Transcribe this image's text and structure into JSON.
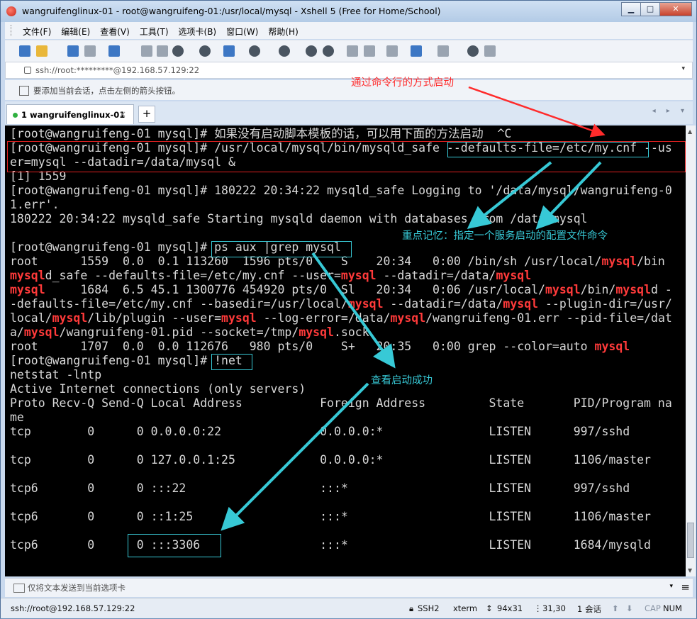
{
  "window": {
    "title": "wangruifenglinux-01 - root@wangruifeng-01:/usr/local/mysql - Xshell 5 (Free for Home/School)",
    "minimize": "▁",
    "maximize": "□",
    "close": "✕"
  },
  "menu": {
    "items": [
      "文件(F)",
      "编辑(E)",
      "查看(V)",
      "工具(T)",
      "选项卡(B)",
      "窗口(W)",
      "帮助(H)"
    ]
  },
  "address": {
    "value": "ssh://root:*********@192.168.57.129:22",
    "dropdown": "▾"
  },
  "hint_bar": {
    "text": "要添加当前会话，点击左侧的箭头按钮。"
  },
  "tabs": {
    "active_label": "1 wangruifenglinux-01",
    "close": "×",
    "add": "+",
    "nav": "◂ ▸ ▾"
  },
  "terminal": {
    "lines": [
      [
        {
          "t": "[root@wangruifeng-01 mysql]# 如果没有启动脚本模板的话，可以用下面的方法启动  ^C",
          "c": ""
        }
      ],
      [
        {
          "t": "[root@wangruifeng-01 mysql]# /usr/local/mysql/bin/mysqld_safe --defaults-file=/etc/my.cnf --us",
          "c": ""
        }
      ],
      [
        {
          "t": "er=mysql --datadir=/data/mysql &",
          "c": ""
        }
      ],
      [
        {
          "t": "[1] 1559",
          "c": ""
        }
      ],
      [
        {
          "t": "[root@wangruifeng-01 mysql]# 180222 20:34:22 mysqld_safe Logging to '/data/mysql/wangruifeng-0",
          "c": ""
        }
      ],
      [
        {
          "t": "1.err'.",
          "c": ""
        }
      ],
      [
        {
          "t": "180222 20:34:22 mysqld_safe Starting mysqld daemon with databases from /data/mysql",
          "c": ""
        }
      ],
      [
        {
          "t": "",
          "c": ""
        }
      ],
      [
        {
          "t": "[root@wangruifeng-01 mysql]# ps aux |grep mysql",
          "c": ""
        }
      ],
      [
        {
          "t": "root      1559  0.0  0.1 113260  1596 pts/0    S    20:34   0:00 /bin/sh /usr/local/",
          "c": ""
        },
        {
          "t": "mysql",
          "c": "r"
        },
        {
          "t": "/bin",
          "c": ""
        }
      ],
      [
        {
          "t": "mysql",
          "c": "r"
        },
        {
          "t": "d_safe --defaults-file=/etc/my.cnf --user=",
          "c": ""
        },
        {
          "t": "mysql",
          "c": "r"
        },
        {
          "t": " --datadir=/data/",
          "c": ""
        },
        {
          "t": "mysql",
          "c": "r"
        }
      ],
      [
        {
          "t": "mysql",
          "c": "r"
        },
        {
          "t": "     1684  6.5 45.1 1300776 454920 pts/0  Sl   20:34   0:06 /usr/local/",
          "c": ""
        },
        {
          "t": "mysql",
          "c": "r"
        },
        {
          "t": "/bin/",
          "c": ""
        },
        {
          "t": "mysql",
          "c": "r"
        },
        {
          "t": "d -",
          "c": ""
        }
      ],
      [
        {
          "t": "-defaults-file=/etc/my.cnf --basedir=/usr/local/",
          "c": ""
        },
        {
          "t": "mysql",
          "c": "r"
        },
        {
          "t": " --datadir=/data/",
          "c": ""
        },
        {
          "t": "mysql",
          "c": "r"
        },
        {
          "t": " --plugin-dir=/usr/",
          "c": ""
        }
      ],
      [
        {
          "t": "local/",
          "c": ""
        },
        {
          "t": "mysql",
          "c": "r"
        },
        {
          "t": "/lib/plugin --user=",
          "c": ""
        },
        {
          "t": "mysql",
          "c": "r"
        },
        {
          "t": " --log-error=/data/",
          "c": ""
        },
        {
          "t": "mysql",
          "c": "r"
        },
        {
          "t": "/wangruifeng-01.err --pid-file=/dat",
          "c": ""
        }
      ],
      [
        {
          "t": "a/",
          "c": ""
        },
        {
          "t": "mysql",
          "c": "r"
        },
        {
          "t": "/wangruifeng-01.pid --socket=/tmp/",
          "c": ""
        },
        {
          "t": "mysql",
          "c": "r"
        },
        {
          "t": ".sock",
          "c": ""
        }
      ],
      [
        {
          "t": "root      1707  0.0  0.0 112676   980 pts/0    S+   20:35   0:00 grep --color=auto ",
          "c": ""
        },
        {
          "t": "mysql",
          "c": "r"
        }
      ],
      [
        {
          "t": "[root@wangruifeng-01 mysql]# !net",
          "c": ""
        }
      ],
      [
        {
          "t": "netstat -lntp",
          "c": ""
        }
      ],
      [
        {
          "t": "Active Internet connections (only servers)",
          "c": ""
        }
      ],
      [
        {
          "t": "Proto Recv-Q Send-Q Local Address           Foreign Address         State       PID/Program na",
          "c": ""
        }
      ],
      [
        {
          "t": "me",
          "c": ""
        }
      ],
      [
        {
          "t": "tcp        0      0 0.0.0.0:22              0.0.0.0:*               LISTEN      997/sshd",
          "c": ""
        }
      ],
      [
        {
          "t": "",
          "c": ""
        }
      ],
      [
        {
          "t": "tcp        0      0 127.0.0.1:25            0.0.0.0:*               LISTEN      1106/master",
          "c": ""
        }
      ],
      [
        {
          "t": "",
          "c": ""
        }
      ],
      [
        {
          "t": "tcp6       0      0 :::22                   :::*                    LISTEN      997/sshd",
          "c": ""
        }
      ],
      [
        {
          "t": "",
          "c": ""
        }
      ],
      [
        {
          "t": "tcp6       0      0 ::1:25                  :::*                    LISTEN      1106/master",
          "c": ""
        }
      ],
      [
        {
          "t": "",
          "c": ""
        }
      ],
      [
        {
          "t": "tcp6       0      0 :::3306                 :::*                    LISTEN      1684/mysqld",
          "c": ""
        }
      ]
    ]
  },
  "annotations": {
    "cmd_start": "通过命令行的方式启动",
    "config_file": "重点记忆：指定一个服务启动的配置文件命令",
    "check_success": "查看启动成功"
  },
  "colors": {
    "annotation_red": "#ff2b2b",
    "annotation_cyan": "#37c9d6",
    "terminal_bg": "#000000",
    "terminal_fg": "#d8d8d8",
    "highlight": "#ff3a3a"
  },
  "send_bar": {
    "placeholder": "仅将文本发送到当前选项卡",
    "dropdown": "▾",
    "menu": "≡"
  },
  "status": {
    "connection": "ssh://root@192.168.57.129:22",
    "protocol": "SSH2",
    "term": "xterm",
    "size": "94x31",
    "cursor": "31,30",
    "sessions": "1 会话",
    "caps": "CAP",
    "num": "NUM"
  }
}
